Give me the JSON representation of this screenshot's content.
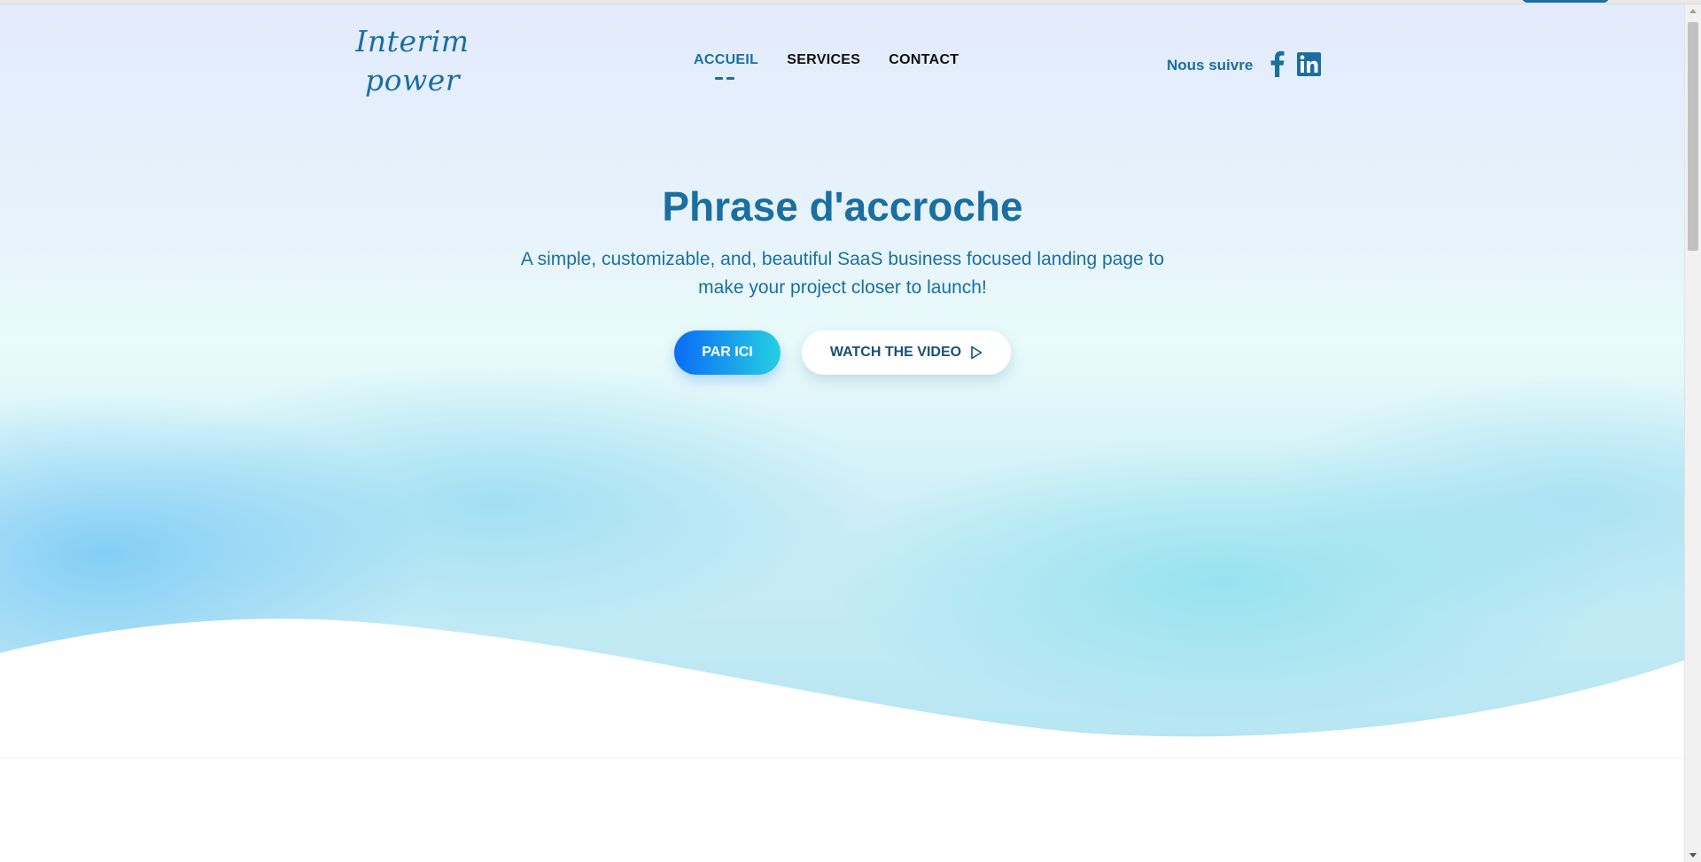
{
  "brand": {
    "name": "Interim power"
  },
  "nav": {
    "items": [
      {
        "label": "ACCUEIL",
        "active": true
      },
      {
        "label": "SERVICES",
        "active": false
      },
      {
        "label": "CONTACT",
        "active": false
      }
    ]
  },
  "social": {
    "label": "Nous suivre",
    "icons": [
      "facebook-icon",
      "linkedin-icon"
    ]
  },
  "hero": {
    "headline": "Phrase d'accroche",
    "subtitle": "A simple, customizable, and, beautiful SaaS business focused landing page to make your project closer to launch!",
    "primary_button": "PAR ICI",
    "secondary_button": "WATCH THE VIDEO",
    "secondary_icon": "play-icon"
  },
  "colors": {
    "brand_blue": "#1b6fa0",
    "button_gradient_start": "#0a6cf5",
    "button_gradient_end": "#26cfe3"
  }
}
